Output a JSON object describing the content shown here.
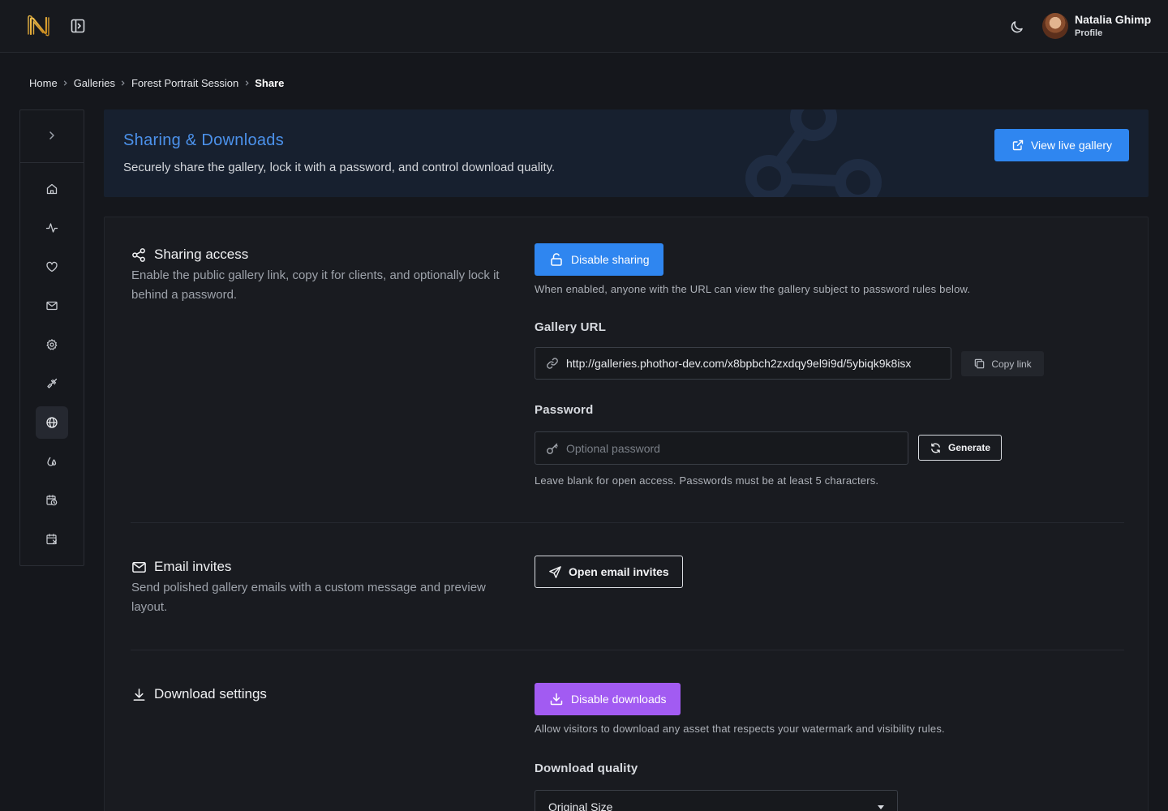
{
  "user": {
    "name": "Natalia Ghimp",
    "role": "Profile"
  },
  "breadcrumb": [
    "Home",
    "Galleries",
    "Forest Portrait Session",
    "Share"
  ],
  "sidebar": {
    "items": [
      {
        "icon": "home-icon"
      },
      {
        "icon": "activity-icon"
      },
      {
        "icon": "heart-icon"
      },
      {
        "icon": "mail-icon"
      },
      {
        "icon": "gear-icon"
      },
      {
        "icon": "brush-icon"
      },
      {
        "icon": "globe-icon",
        "active": true
      },
      {
        "icon": "drops-icon"
      },
      {
        "icon": "calendar-clock-icon"
      },
      {
        "icon": "calendar-x-icon"
      }
    ]
  },
  "hero": {
    "title": "Sharing & Downloads",
    "subtitle": "Securely share the gallery, lock it with a password, and control download quality.",
    "button_label": "View live gallery"
  },
  "sharing": {
    "title": "Sharing access",
    "description": "Enable the public gallery link, copy it for clients, and optionally lock it behind a password.",
    "toggle_label": "Disable sharing",
    "toggle_help": "When enabled, anyone with the URL can view the gallery subject to password rules below.",
    "url_label": "Gallery URL",
    "url_value": "http://galleries.phothor-dev.com/x8bpbch2zxdqy9el9i9d/5ybiqk9k8isx",
    "copy_label": "Copy link",
    "password_label": "Password",
    "password_placeholder": "Optional password",
    "password_value": "",
    "generate_label": "Generate",
    "password_help": "Leave blank for open access. Passwords must be at least 5 characters."
  },
  "email": {
    "title": "Email invites",
    "description": "Send polished gallery emails with a custom message and preview layout.",
    "button_label": "Open email invites"
  },
  "downloads": {
    "title": "Download settings",
    "toggle_label": "Disable downloads",
    "toggle_help": "Allow visitors to download any asset that respects your watermark and visibility rules.",
    "quality_label": "Download quality",
    "quality_value": "Original Size"
  },
  "colors": {
    "accent_blue": "#2f86f0",
    "accent_purple": "#a25bf2",
    "hero_title": "#4c92ec",
    "background": "#15171c"
  }
}
